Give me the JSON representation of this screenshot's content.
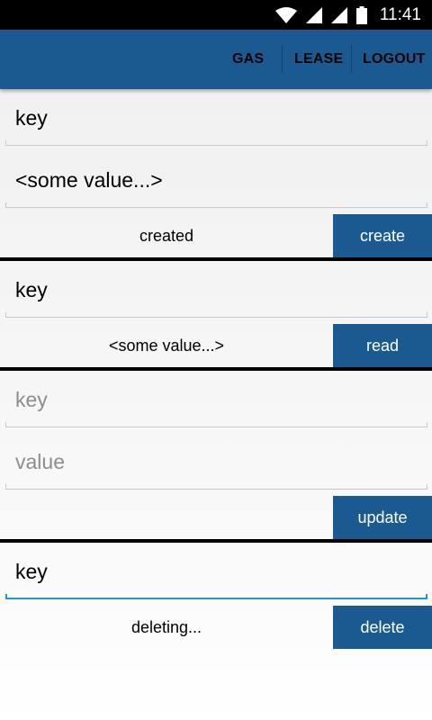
{
  "statusbar": {
    "time": "11:41",
    "icons": [
      "wifi-icon",
      "signal-icon",
      "signal-icon",
      "battery-icon"
    ]
  },
  "toolbar": {
    "menu": [
      "GAS",
      "LEASE",
      "LOGOUT"
    ],
    "color": "#1b5a91"
  },
  "create": {
    "key": "key",
    "value": "<some value...>",
    "status": "created",
    "button": "create"
  },
  "read": {
    "key": "key",
    "status": "<some value...>",
    "button": "read"
  },
  "update": {
    "key_placeholder": "key",
    "value_placeholder": "value",
    "button": "update"
  },
  "delete": {
    "key": "key",
    "status": "deleting...",
    "button": "delete"
  }
}
